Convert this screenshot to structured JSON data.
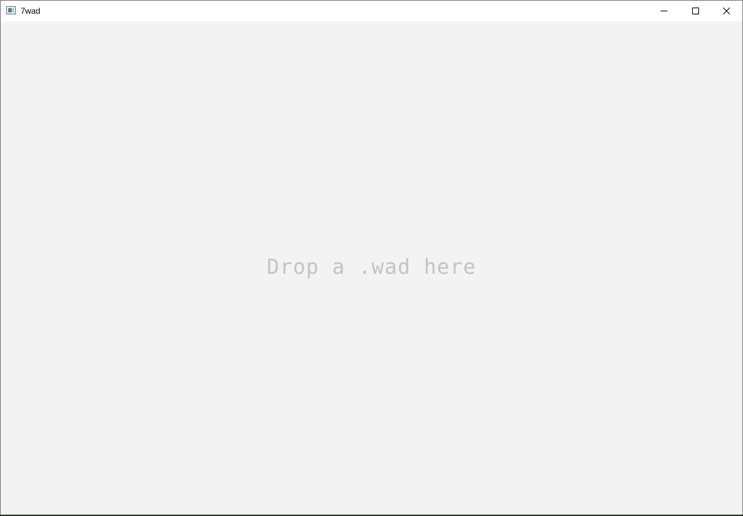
{
  "window": {
    "title": "7wad",
    "app_icon": "window-app-icon",
    "controls": {
      "minimize_icon": "minimize-icon",
      "maximize_icon": "maximize-icon",
      "close_icon": "close-icon"
    }
  },
  "main": {
    "drop_hint": "Drop a .wad here"
  },
  "colors": {
    "titlebar": "#ffffff",
    "client_background": "#f3f3f3",
    "hint_text": "#c3c3c3"
  }
}
